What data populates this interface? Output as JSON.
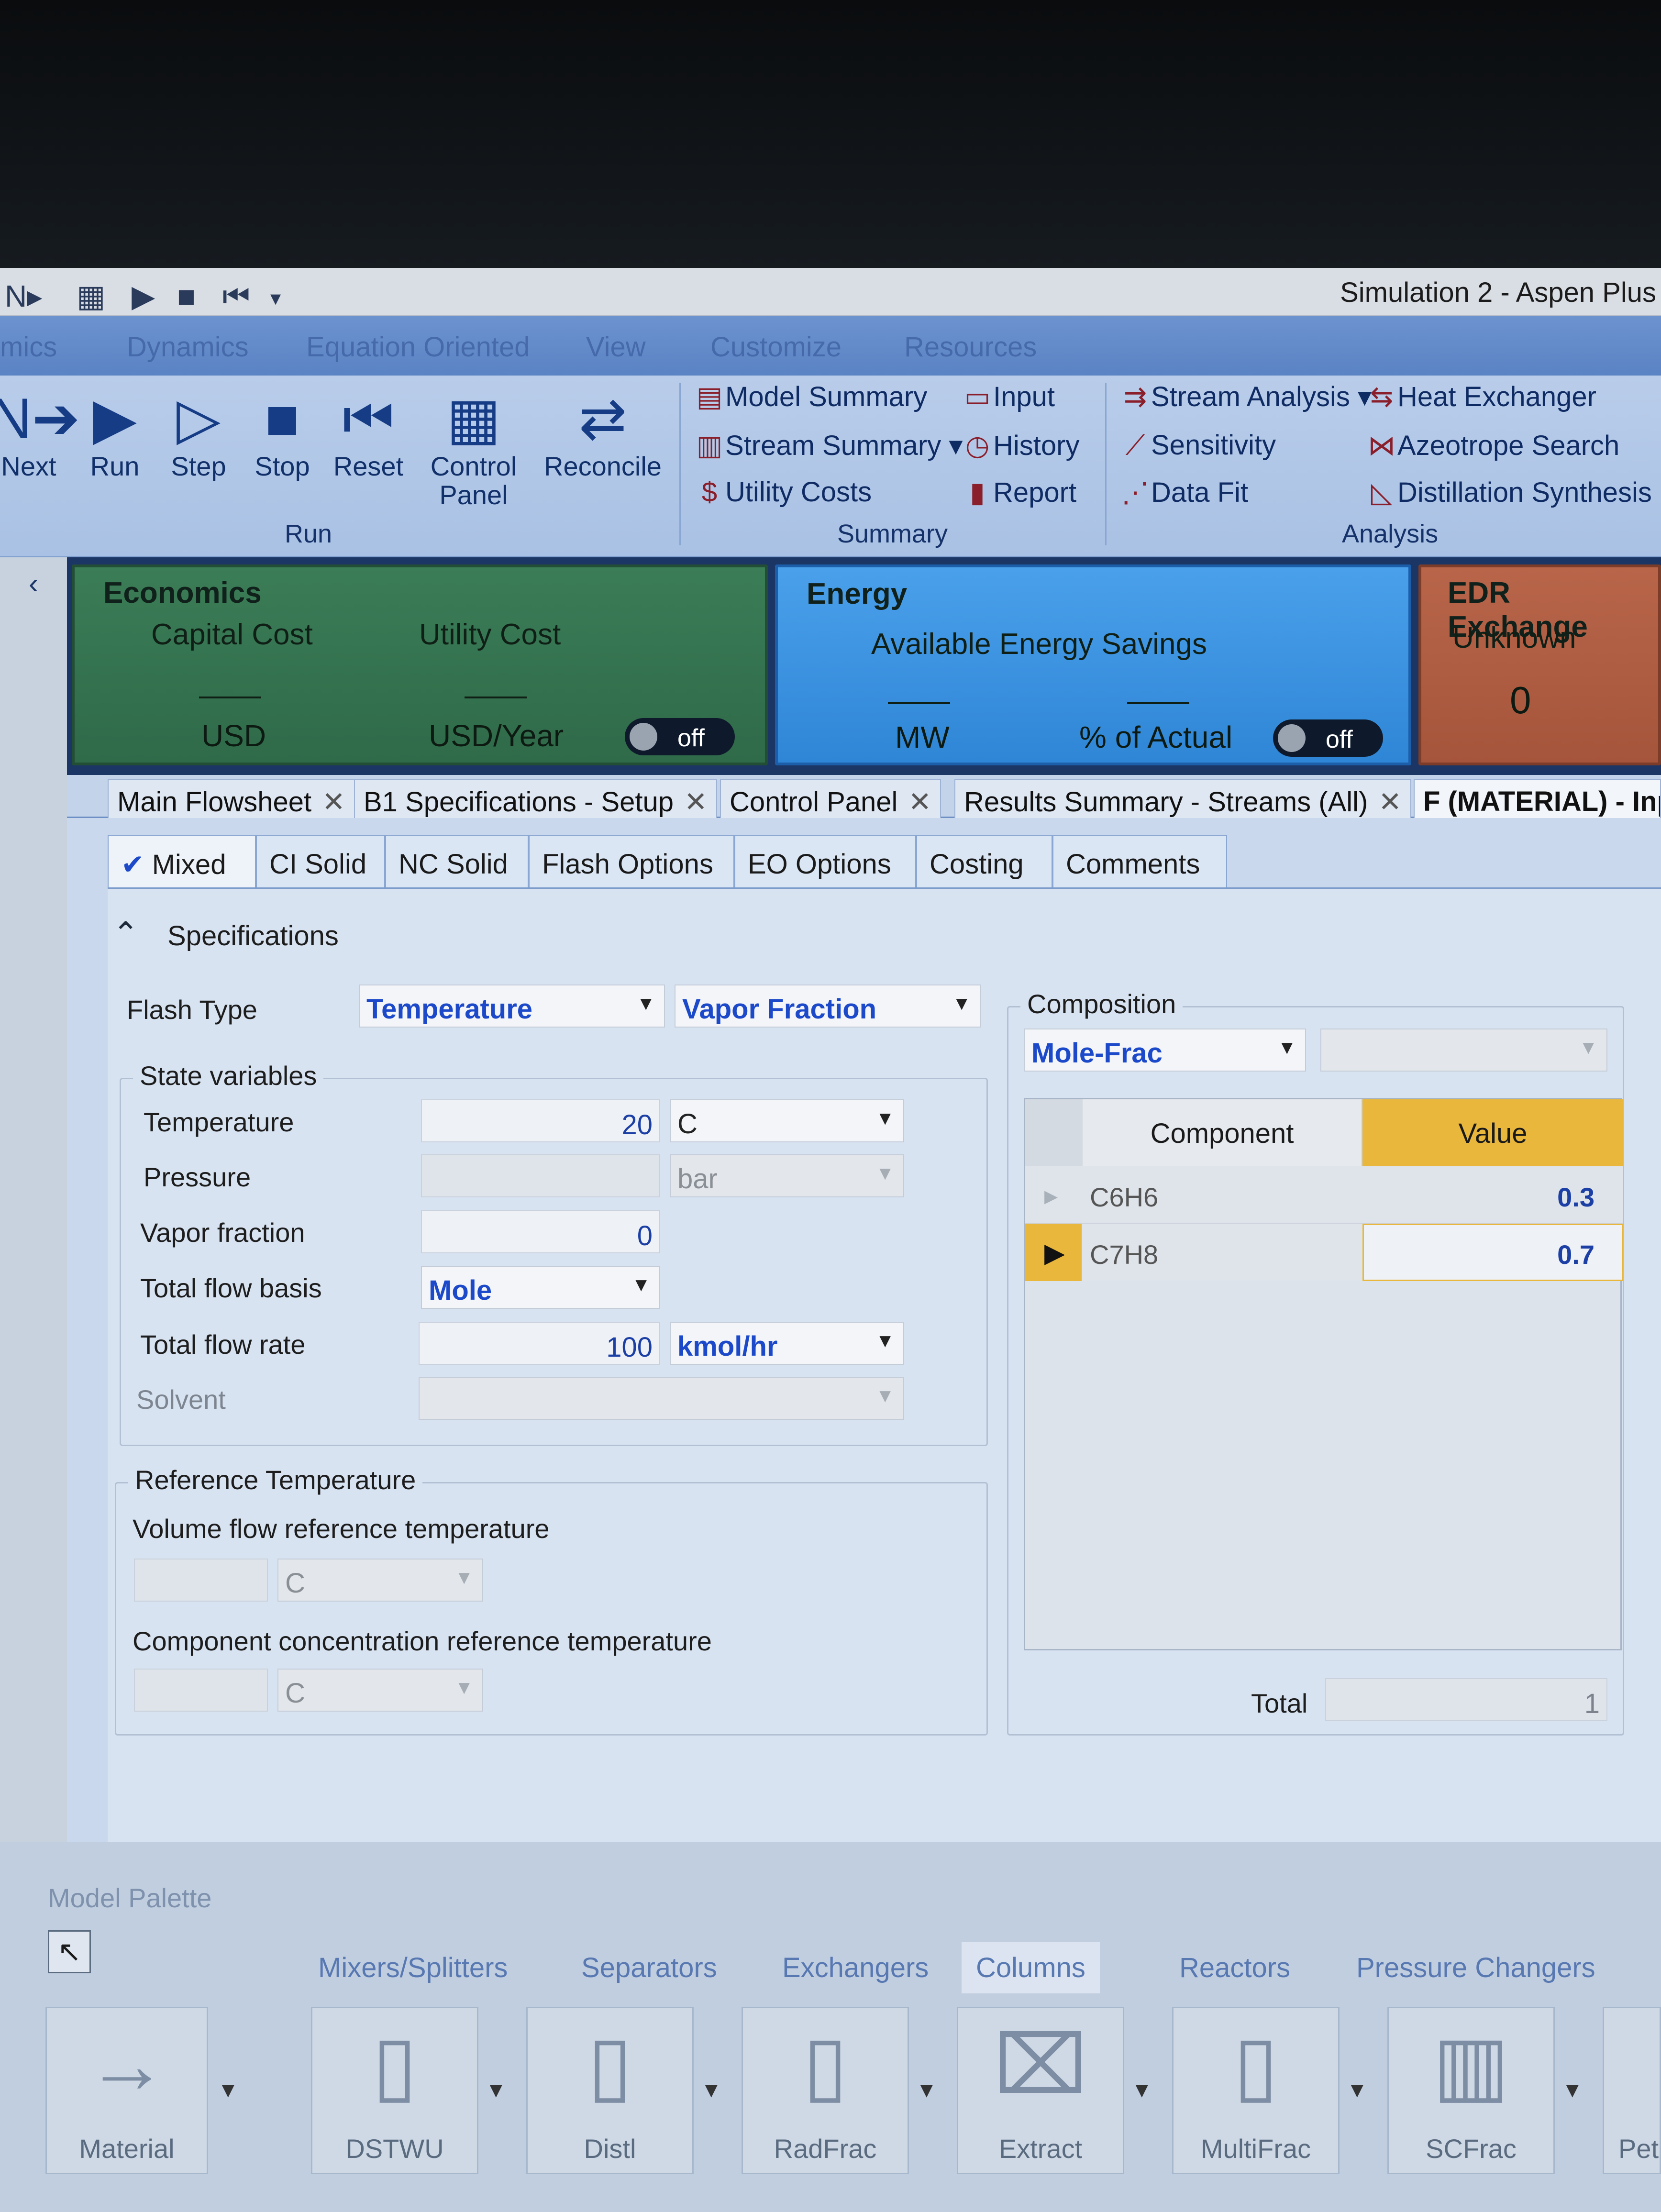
{
  "window": {
    "title": "Simulation 2 - Aspen Plus"
  },
  "quick_access": {
    "icons": [
      "next-icon",
      "grid-icon",
      "run-icon",
      "stop-icon",
      "reset-icon",
      "dropdown-icon"
    ]
  },
  "menu": {
    "tabs": [
      "mics",
      "Dynamics",
      "Equation Oriented",
      "View",
      "Customize",
      "Resources"
    ]
  },
  "ribbon": {
    "run_group": {
      "label": "Run",
      "buttons": [
        "Next",
        "Run",
        "Step",
        "Stop",
        "Reset",
        "Control Panel",
        "Reconcile"
      ]
    },
    "summary_group": {
      "label": "Summary",
      "items": [
        "Model Summary",
        "Stream Summary",
        "Utility Costs",
        "Input",
        "History",
        "Report"
      ]
    },
    "analysis_group": {
      "label": "Analysis",
      "items": [
        "Stream Analysis",
        "Sensitivity",
        "Data Fit",
        "Heat Exchanger",
        "Azeotrope Search",
        "Distillation Synthesis"
      ]
    }
  },
  "dashboard": {
    "economics": {
      "title": "Economics",
      "capital_label": "Capital Cost",
      "utility_label": "Utility Cost",
      "capital_unit": "USD",
      "utility_unit": "USD/Year",
      "toggle": "off"
    },
    "energy": {
      "title": "Energy",
      "subtitle": "Available Energy Savings",
      "unit1": "MW",
      "unit2": "% of Actual",
      "toggle": "off"
    },
    "edr": {
      "title": "EDR Exchange",
      "status": "Unknown",
      "count": "0"
    }
  },
  "doc_tabs": [
    "Main Flowsheet",
    "B1 Specifications - Setup",
    "Control Panel",
    "Results Summary - Streams (All)",
    "F (MATERIAL) - Inpu"
  ],
  "sub_tabs": [
    "Mixed",
    "CI Solid",
    "NC Solid",
    "Flash Options",
    "EO Options",
    "Costing",
    "Comments"
  ],
  "specifications": {
    "header": "Specifications",
    "flash_type_label": "Flash Type",
    "flash_type_1": "Temperature",
    "flash_type_2": "Vapor Fraction",
    "state_vars_title": "State variables",
    "temperature_label": "Temperature",
    "temperature_value": "20",
    "temperature_unit": "C",
    "pressure_label": "Pressure",
    "pressure_unit": "bar",
    "vapor_label": "Vapor fraction",
    "vapor_value": "0",
    "flow_basis_label": "Total flow basis",
    "flow_basis_value": "Mole",
    "flow_rate_label": "Total flow rate",
    "flow_rate_value": "100",
    "flow_rate_unit": "kmol/hr",
    "solvent_label": "Solvent"
  },
  "reference": {
    "title": "Reference Temperature",
    "vol_label": "Volume flow reference temperature",
    "vol_unit": "C",
    "comp_label": "Component concentration reference temperature",
    "comp_unit": "C"
  },
  "composition": {
    "title": "Composition",
    "basis": "Mole-Frac",
    "col_component": "Component",
    "col_value": "Value",
    "rows": [
      {
        "component": "C6H6",
        "value": "0.3"
      },
      {
        "component": "C7H8",
        "value": "0.7"
      }
    ],
    "total_label": "Total",
    "total_value": "1"
  },
  "palette": {
    "title": "Model Palette",
    "tabs": [
      "Mixers/Splitters",
      "Separators",
      "Exchangers",
      "Columns",
      "Reactors",
      "Pressure Changers"
    ],
    "items": [
      "Material",
      "DSTWU",
      "Distl",
      "RadFrac",
      "Extract",
      "MultiFrac",
      "SCFrac",
      "Pet"
    ]
  }
}
